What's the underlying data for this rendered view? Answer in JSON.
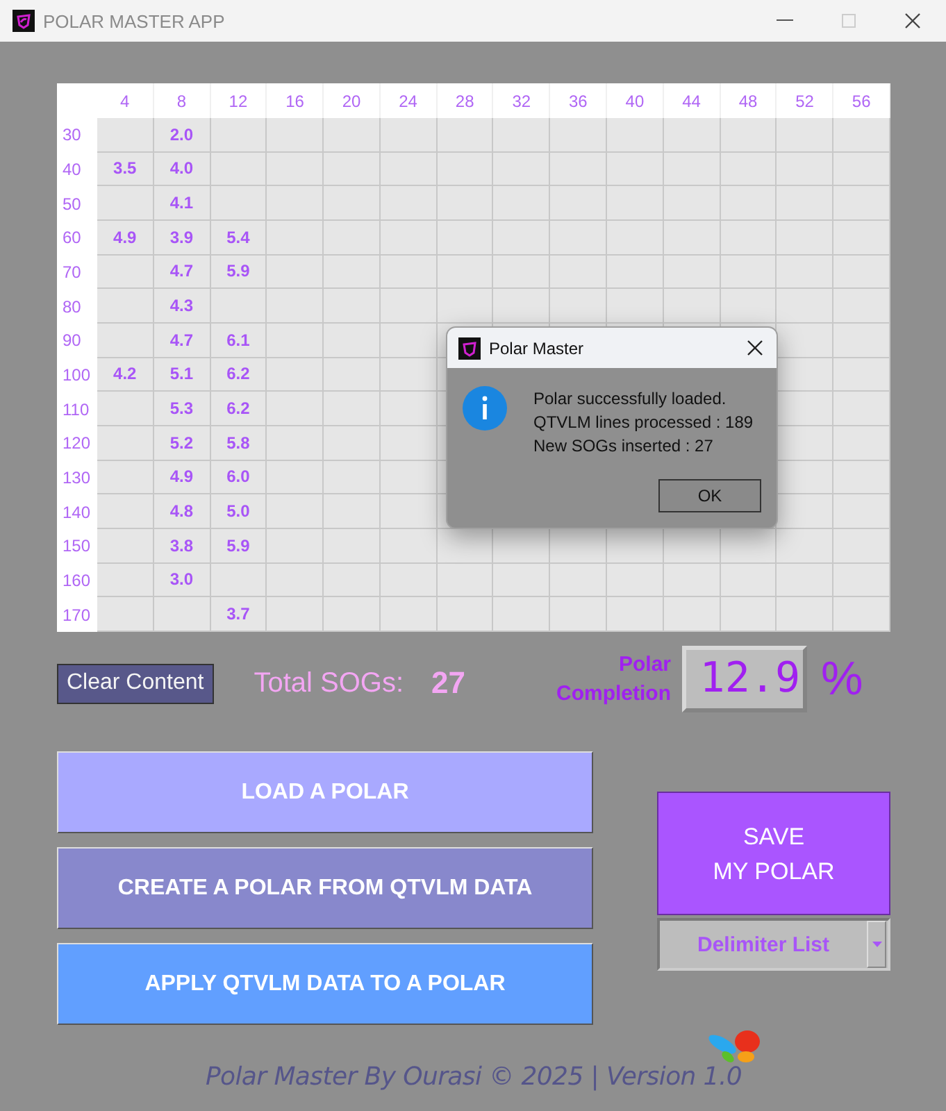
{
  "window": {
    "title": "POLAR MASTER APP"
  },
  "table": {
    "columns": [
      "4",
      "8",
      "12",
      "16",
      "20",
      "24",
      "28",
      "32",
      "36",
      "40",
      "44",
      "48",
      "52",
      "56"
    ],
    "rows": [
      {
        "label": "30",
        "cells": [
          null,
          "2.0"
        ]
      },
      {
        "label": "40",
        "cells": [
          "3.5",
          "4.0"
        ]
      },
      {
        "label": "50",
        "cells": [
          null,
          "4.1"
        ]
      },
      {
        "label": "60",
        "cells": [
          "4.9",
          "3.9",
          "5.4"
        ]
      },
      {
        "label": "70",
        "cells": [
          null,
          "4.7",
          "5.9"
        ]
      },
      {
        "label": "80",
        "cells": [
          null,
          "4.3"
        ]
      },
      {
        "label": "90",
        "cells": [
          null,
          "4.7",
          "6.1"
        ]
      },
      {
        "label": "100",
        "cells": [
          "4.2",
          "5.1",
          "6.2"
        ]
      },
      {
        "label": "110",
        "cells": [
          null,
          "5.3",
          "6.2"
        ]
      },
      {
        "label": "120",
        "cells": [
          null,
          "5.2",
          "5.8"
        ]
      },
      {
        "label": "130",
        "cells": [
          null,
          "4.9",
          "6.0"
        ]
      },
      {
        "label": "140",
        "cells": [
          null,
          "4.8",
          "5.0"
        ]
      },
      {
        "label": "150",
        "cells": [
          null,
          "3.8",
          "5.9"
        ]
      },
      {
        "label": "160",
        "cells": [
          null,
          "3.0"
        ]
      },
      {
        "label": "170",
        "cells": [
          null,
          null,
          "3.7"
        ]
      }
    ]
  },
  "dialog": {
    "title": "Polar Master",
    "lines": [
      "Polar successfully loaded.",
      "QTVLM lines processed : 189",
      "New SOGs inserted : 27"
    ],
    "button": "OK"
  },
  "clear_button": "Clear Content",
  "total": {
    "label": "Total SOGs:",
    "value": "27"
  },
  "completion": {
    "label": "Polar Completion",
    "value": "12.9",
    "unit": "%"
  },
  "actions": [
    {
      "label": "LOAD A POLAR",
      "color": "#a9a9ff"
    },
    {
      "label": "CREATE A POLAR FROM QTVLM DATA",
      "color": "#8888cc"
    },
    {
      "label": "APPLY QTVLM DATA TO A POLAR",
      "color": "#619fff"
    }
  ],
  "save_button": "SAVE\nMY POLAR",
  "delimiter_dropdown": {
    "value": "Delimiter List"
  },
  "footer": "Polar Master By Ourasi © 2025 | Version 1.0"
}
